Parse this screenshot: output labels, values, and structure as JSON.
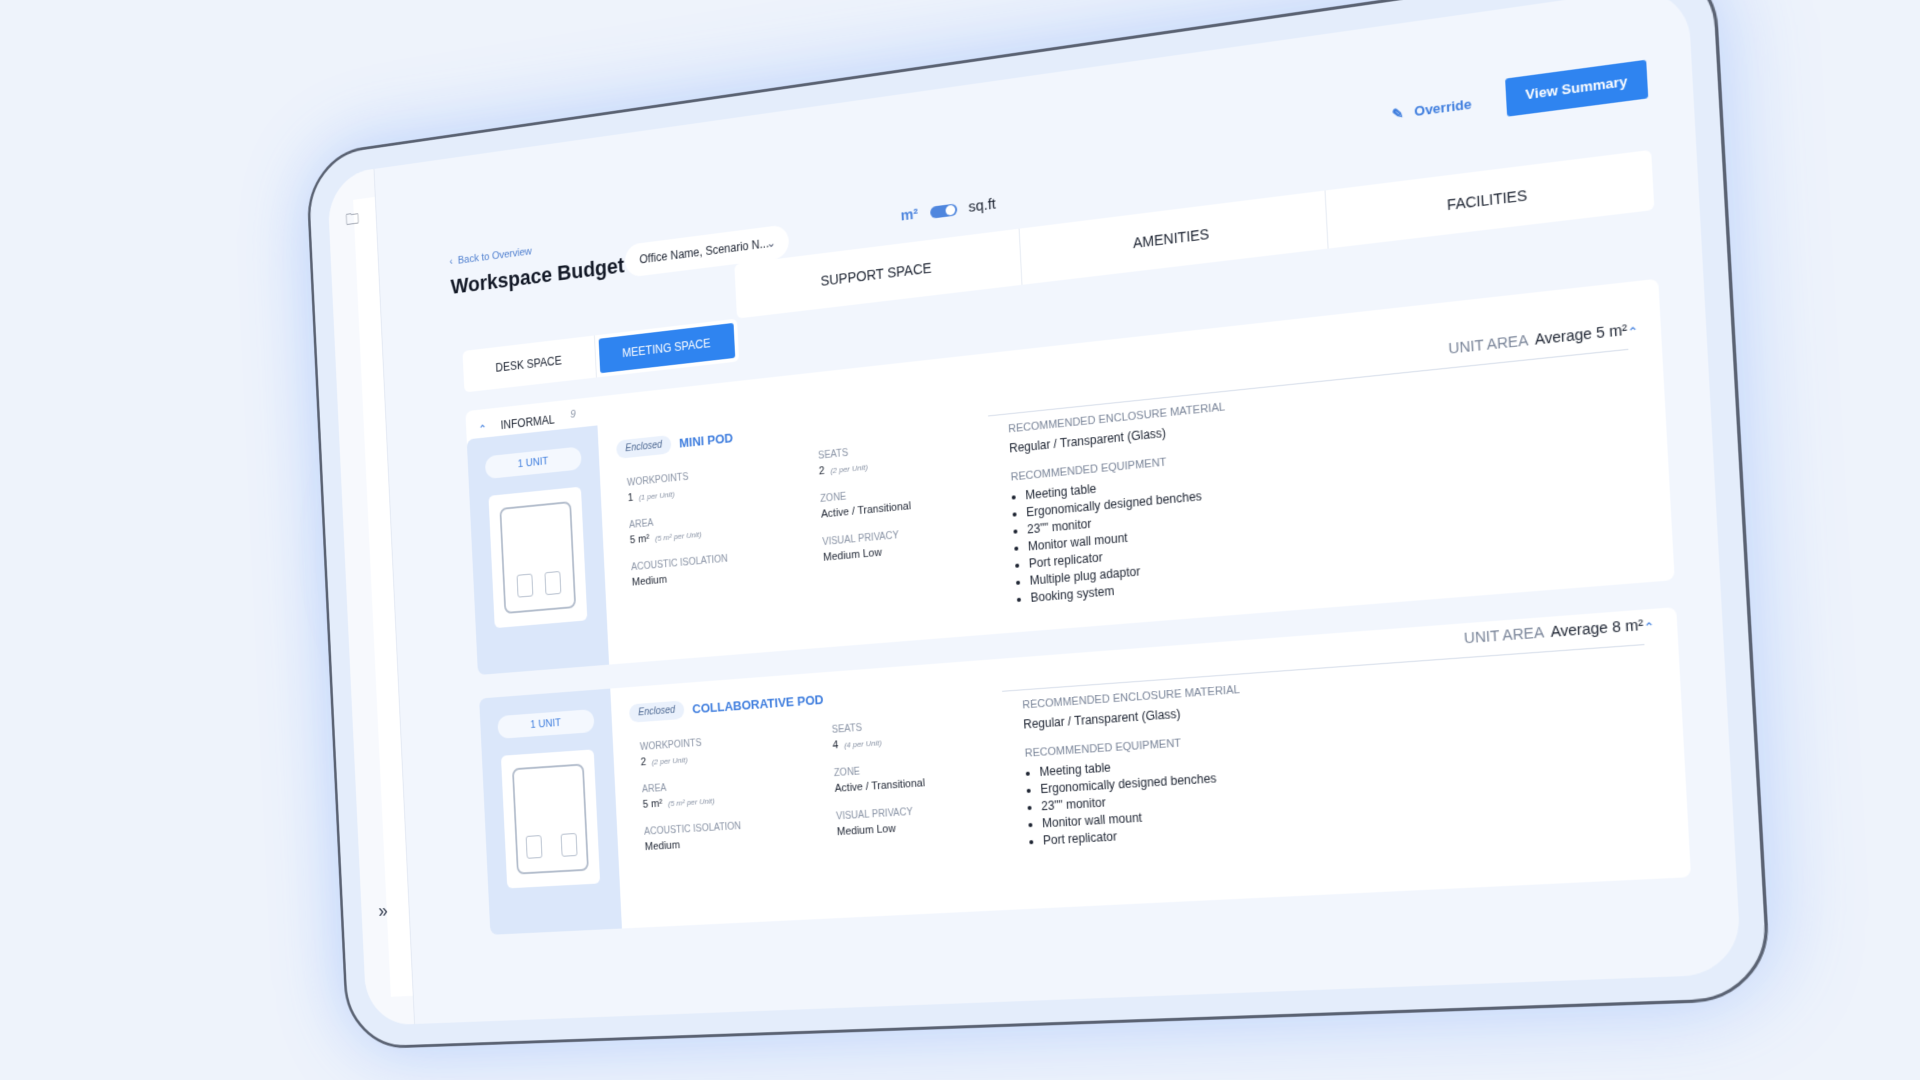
{
  "header": {
    "back_label": "Back to Overview",
    "title": "Workspace Budget",
    "scenario_value": "Office Name, Scenario N...",
    "unit_metric": "m²",
    "unit_imperial": "sq.ft",
    "override_label": "Override",
    "view_summary_label": "View Summary"
  },
  "tabs": {
    "upper": [
      "SUPPORT SPACE",
      "AMENITIES",
      "FACILITIES"
    ],
    "lower": [
      "DESK SPACE",
      "MEETING SPACE"
    ],
    "active": "MEETING SPACE"
  },
  "group": {
    "label": "INFORMAL",
    "count": "9"
  },
  "cards": [
    {
      "units": "1 UNIT",
      "badge": "Enclosed",
      "name": "MINI POD",
      "unit_area_label": "UNIT AREA",
      "unit_area_value": "Average 5 m²",
      "workpoints_label": "WORKPOINTS",
      "workpoints": "1",
      "workpoints_sub": "(1 per Unit)",
      "seats_label": "SEATS",
      "seats": "2",
      "seats_sub": "(2 per Unit)",
      "area_label": "AREA",
      "area": "5 m²",
      "area_sub": "(5 m² per Unit)",
      "zone_label": "ZONE",
      "zone": "Active / Transitional",
      "acoustic_label": "ACOUSTIC ISOLATION",
      "acoustic": "Medium",
      "privacy_label": "VISUAL PRIVACY",
      "privacy": "Medium Low",
      "enclosure_label": "RECOMMENDED ENCLOSURE MATERIAL",
      "enclosure": "Regular / Transparent (Glass)",
      "equipment_label": "RECOMMENDED EQUIPMENT",
      "equipment": [
        "Meeting table",
        "Ergonomically designed benches",
        "23\"\" monitor",
        "Monitor wall mount",
        "Port replicator",
        "Multiple plug adaptor",
        "Booking system"
      ]
    },
    {
      "units": "1 UNIT",
      "badge": "Enclosed",
      "name": "COLLABORATIVE POD",
      "unit_area_label": "UNIT AREA",
      "unit_area_value": "Average 8 m²",
      "workpoints_label": "WORKPOINTS",
      "workpoints": "2",
      "workpoints_sub": "(2 per Unit)",
      "seats_label": "SEATS",
      "seats": "4",
      "seats_sub": "(4 per Unit)",
      "area_label": "AREA",
      "area": "5 m²",
      "area_sub": "(5 m² per Unit)",
      "zone_label": "ZONE",
      "zone": "Active / Transitional",
      "acoustic_label": "ACOUSTIC ISOLATION",
      "acoustic": "Medium",
      "privacy_label": "VISUAL PRIVACY",
      "privacy": "Medium Low",
      "enclosure_label": "RECOMMENDED ENCLOSURE MATERIAL",
      "enclosure": "Regular / Transparent (Glass)",
      "equipment_label": "RECOMMENDED EQUIPMENT",
      "equipment": [
        "Meeting table",
        "Ergonomically designed benches",
        "23\"\" monitor",
        "Monitor wall mount",
        "Port replicator"
      ]
    }
  ],
  "icons": {
    "folder": "folder-icon",
    "expand": "double-chevron-right-icon",
    "pencil": "pencil-icon",
    "caret": "caret-up-icon"
  },
  "colors": {
    "accent": "#2f84f0",
    "background": "#eef3fb",
    "panel": "#dbe7fa"
  }
}
